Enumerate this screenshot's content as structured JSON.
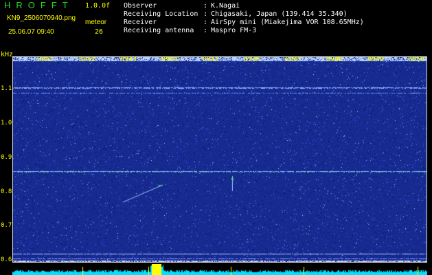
{
  "header": {
    "app_title": "HROFFT",
    "version": "1.0.0f",
    "file_name": "KN9_2506070940.png",
    "date_time": "25.06.07 09:40",
    "meteor_label": "meteor",
    "meteor_count": "26",
    "info": [
      {
        "key": "Observer",
        "value": "K.Nagai"
      },
      {
        "key": "Receiving Location",
        "value": "Chigasaki, Japan (139.414 35.340)"
      },
      {
        "key": "Receiver",
        "value": "AirSpy mini (Miakejima VOR 108.65MHz)"
      },
      {
        "key": "Receiving antenna",
        "value": "Maspro FM-3"
      }
    ]
  },
  "spectrogram": {
    "freq_unit": "kHz",
    "time_labels": [
      "0941",
      "0942",
      "0943",
      "0944",
      "0945",
      "0946",
      "0947",
      "0948",
      "0949",
      "0950"
    ],
    "freq_labels": [
      "1.1",
      "1.0",
      "0.9",
      "0.8",
      "0.7",
      "0.6"
    ],
    "colors": {
      "background": "#162a90",
      "noise_hi": "#4466ff",
      "noise_white": "#cfd8ff",
      "trace": "#7fa8ff",
      "echo": "#33dd55",
      "spectrum": "#00e0ff",
      "spectrum_peak": "#ffff00"
    }
  }
}
